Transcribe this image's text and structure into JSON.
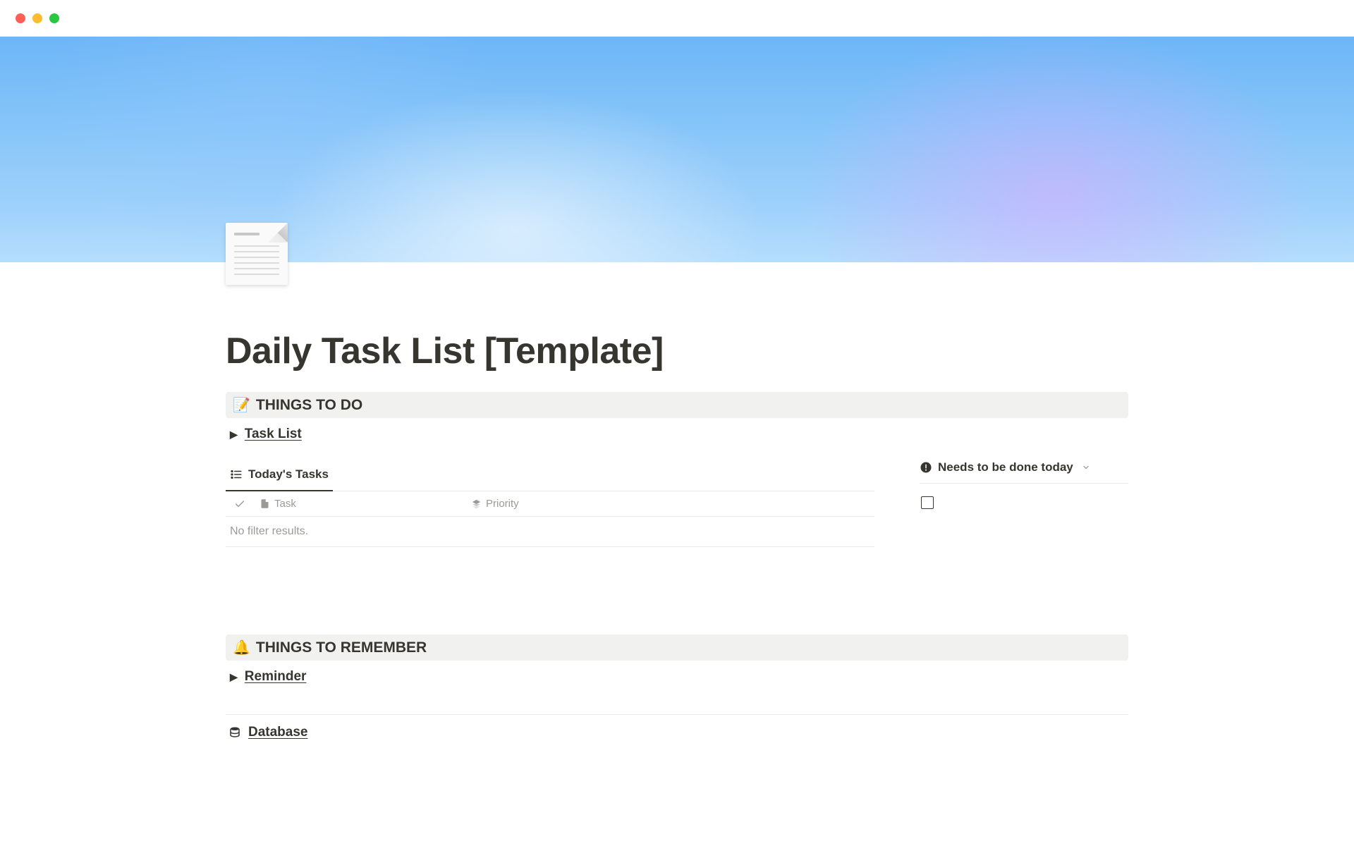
{
  "page": {
    "title": "Daily Task List  [Template]"
  },
  "sections": {
    "todo": {
      "emoji": "📝",
      "label": "THINGS TO DO",
      "toggle_label": "Task List",
      "tab_label": "Today's Tasks",
      "columns": {
        "task": "Task",
        "priority": "Priority"
      },
      "empty_message": "No filter results.",
      "urgent_label": "Needs to be done today"
    },
    "remember": {
      "emoji": "🔔",
      "label": "THINGS TO REMEMBER",
      "toggle_label": "Reminder"
    },
    "database": {
      "label": "Database"
    }
  }
}
